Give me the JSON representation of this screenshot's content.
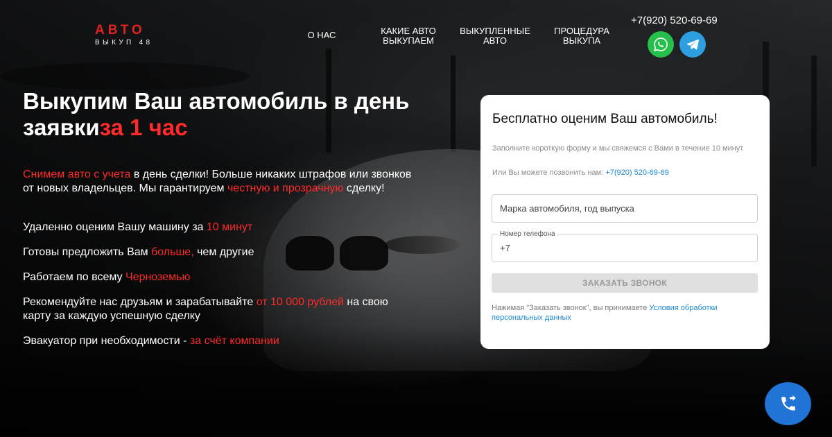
{
  "brand": {
    "main": "АВТО",
    "sub": "ВЫКУП 48"
  },
  "nav": [
    {
      "label": "О НАС"
    },
    {
      "label": "КАКИЕ АВТО ВЫКУПАЕМ"
    },
    {
      "label": "ВЫКУПЛЕННЫЕ АВТО"
    },
    {
      "label": "ПРОЦЕДУРА ВЫКУПА"
    }
  ],
  "contact": {
    "phone": "+7(920) 520-69-69",
    "whatsapp_icon": "whatsapp-icon",
    "telegram_icon": "telegram-icon"
  },
  "hero": {
    "headline_main": "Выкупим Ваш автомобиль в день заявки",
    "headline_accent": "за 1 час",
    "benefits": [
      {
        "red": "Снимем авто с учета",
        "rest": " в день сделки! Больше никаких штрафов или звонков от новых владельцев. Мы гарантируем ",
        "red2": "честную и прозрачную",
        "rest2": " сделку!"
      },
      {
        "text": "Удаленно оценим Вашу машину за ",
        "red": "10 минут"
      },
      {
        "text": "Готовы предложить Вам ",
        "red": "больше,",
        "rest": " чем другие"
      },
      {
        "text": "Работаем по всему ",
        "red": "Черноземью"
      },
      {
        "text": "Рекомендуйте нас друзьям и зарабатывайте ",
        "red": "от 10 000 рублей",
        "rest": " на свою карту за каждую успешную сделку"
      },
      {
        "text": "Эвакуатор при необходимости - ",
        "red": "за счёт компании"
      }
    ]
  },
  "form": {
    "title": "Бесплатно оценим Ваш автомобиль!",
    "note": "Заполните короткую форму и мы свяжемся с Вами в течение 10 минут",
    "call_note": "Или Вы можете позвонить нам: ",
    "call_phone": "+7(920) 520-69-69",
    "car_placeholder": "Марка автомобиля, год выпуска",
    "phone_label": "Номер телефона",
    "phone_value": "+7",
    "submit_label": "ЗАКАЗАТЬ ЗВОНОК",
    "consent_text": "Нажимая \"Заказать звонок\", вы принимаете ",
    "consent_link": "Условия обработки персональных данных"
  },
  "colors": {
    "accent": "#ff2a2a",
    "whatsapp": "#25c04c",
    "telegram": "#2d9fe0",
    "fab": "#1f74d6"
  }
}
